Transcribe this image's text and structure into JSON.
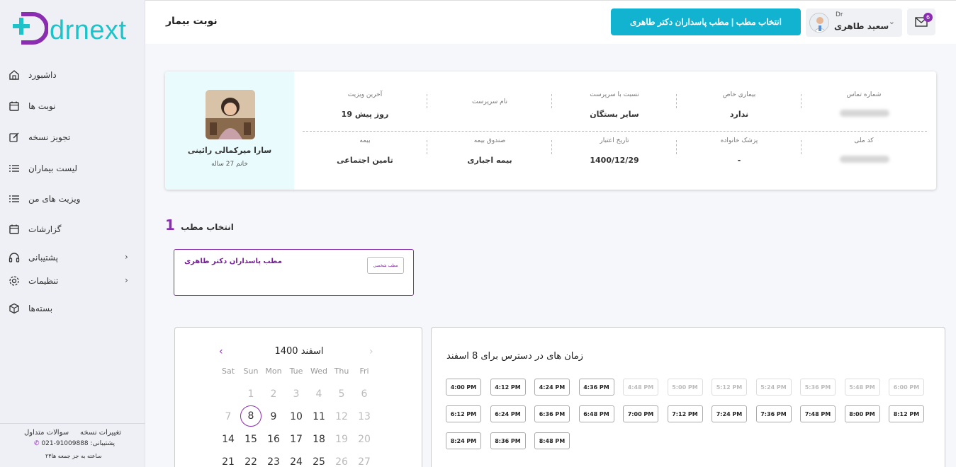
{
  "header": {
    "page_title": "نوبت بیمار",
    "select_clinic_label": "انتخاب مطب | مطب پاسداران دکتر طاهری",
    "user_prefix": "Dr",
    "user_name": "سعید طاهری",
    "mail_count": "6"
  },
  "sidebar": {
    "logo_text": "drnext",
    "items": [
      {
        "label": "داشبورد",
        "icon": "home-icon"
      },
      {
        "label": "نوبت ها",
        "icon": "calendar-icon"
      },
      {
        "label": "تجویز نسخه",
        "icon": "edit-icon"
      },
      {
        "label": "لیست بیماران",
        "icon": "list-icon"
      },
      {
        "label": "ویزیت های من",
        "icon": "list-icon"
      },
      {
        "label": "گزارشات",
        "icon": "calendar-icon"
      },
      {
        "label": "پشتیبانی",
        "icon": "headset-icon"
      },
      {
        "label": "تنظیمات",
        "icon": "gear-icon"
      },
      {
        "label": "بسته‌ها",
        "icon": "box-icon"
      }
    ],
    "footer": {
      "faq": "سوالات متداول",
      "changes": "تغییرات نسخه",
      "support_phone": "021-91009888 :پشتیبانی",
      "hours": "۲۴ساعته به جز جمعه ها"
    }
  },
  "patient": {
    "name": "سارا میرکمالی رائینی",
    "age_text": "خانم 27 ساله",
    "fields_row1": [
      {
        "key": "آخرین ویزیت",
        "value": "19 روز پیش"
      },
      {
        "key": "نام سرپرست",
        "value": ""
      },
      {
        "key": "نسبت با سرپرست",
        "value": "سایر بستگان"
      },
      {
        "key": "بیماری خاص",
        "value": "ندارد"
      },
      {
        "key": "شماره تماس",
        "value": ""
      }
    ],
    "fields_row2": [
      {
        "key": "بیمه",
        "value": "تامین اجتماعی"
      },
      {
        "key": "صندوق بیمه",
        "value": "بیمه اجباری"
      },
      {
        "key": "تاریخ اعتبار",
        "value": "1400/12/29"
      },
      {
        "key": "پزشک خانواده",
        "value": "-"
      },
      {
        "key": "کد ملی",
        "value": ""
      }
    ]
  },
  "clinic_section": {
    "step": "1",
    "title": "انتخاب مطب",
    "clinic_name": "مطب پاسداران دکتر طاهری",
    "clinic_type": "مطب شخصی"
  },
  "calendar": {
    "title": "اسفند 1400",
    "weekdays": [
      "Sat",
      "Sun",
      "Mon",
      "Tue",
      "Wed",
      "Thu",
      "Fri"
    ],
    "rows": [
      [
        "",
        "1",
        "2",
        "3",
        "4",
        "5",
        "6"
      ],
      [
        "7",
        "8",
        "9",
        "10",
        "11",
        "12",
        "13"
      ],
      [
        "14",
        "15",
        "16",
        "17",
        "18",
        "19",
        "20"
      ],
      [
        "21",
        "22",
        "23",
        "24",
        "25",
        "26",
        "27"
      ]
    ],
    "selected_day": "8"
  },
  "times": {
    "title": "زمان های در دسترس برای 8 اسفند",
    "slots": [
      {
        "t": "4:00 PM",
        "on": true
      },
      {
        "t": "4:12 PM",
        "on": true
      },
      {
        "t": "4:24 PM",
        "on": true
      },
      {
        "t": "4:36 PM",
        "on": true
      },
      {
        "t": "4:48 PM",
        "on": false
      },
      {
        "t": "5:00 PM",
        "on": false
      },
      {
        "t": "5:12 PM",
        "on": false
      },
      {
        "t": "5:24 PM",
        "on": false
      },
      {
        "t": "5:36 PM",
        "on": false
      },
      {
        "t": "5:48 PM",
        "on": false
      },
      {
        "t": "6:00 PM",
        "on": false
      },
      {
        "t": "6:12 PM",
        "on": true
      },
      {
        "t": "6:24 PM",
        "on": true
      },
      {
        "t": "6:36 PM",
        "on": true
      },
      {
        "t": "6:48 PM",
        "on": true
      },
      {
        "t": "7:00 PM",
        "on": true
      },
      {
        "t": "7:12 PM",
        "on": true
      },
      {
        "t": "7:24 PM",
        "on": true
      },
      {
        "t": "7:36 PM",
        "on": true
      },
      {
        "t": "7:48 PM",
        "on": true
      },
      {
        "t": "8:00 PM",
        "on": true
      },
      {
        "t": "8:12 PM",
        "on": true
      },
      {
        "t": "8:24 PM",
        "on": true
      },
      {
        "t": "8:36 PM",
        "on": true
      },
      {
        "t": "8:48 PM",
        "on": true
      }
    ]
  },
  "colors": {
    "accent": "#12b3d1",
    "brand_purple": "#8a2db0",
    "patient_panel": "#e9fbfd"
  }
}
